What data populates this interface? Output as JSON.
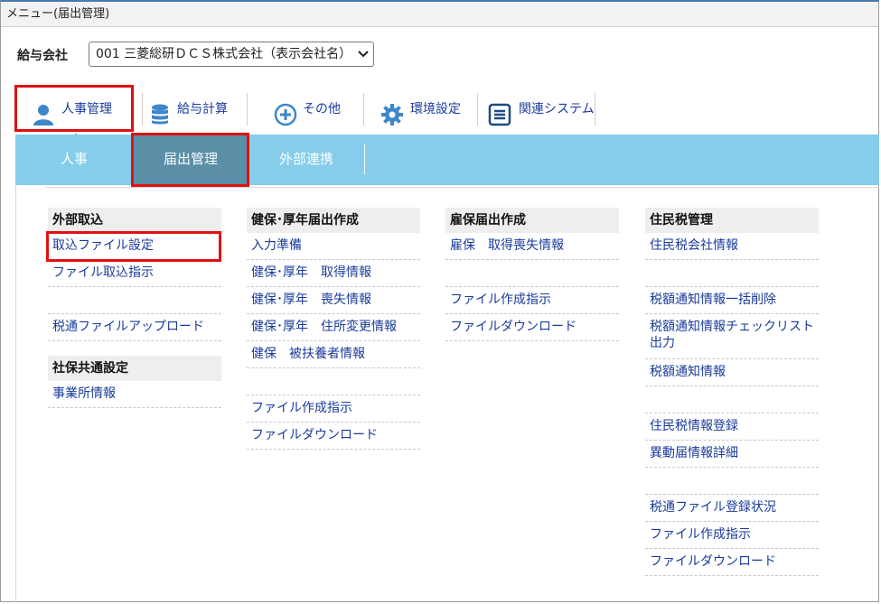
{
  "title_bar": "メニュー(届出管理)",
  "company": {
    "label": "給与会社",
    "selected": "001 三菱総研ＤＣＳ株式会社（表示会社名）"
  },
  "top_menu": [
    {
      "label": "人事管理",
      "icon": "person-icon"
    },
    {
      "label": "給与計算",
      "icon": "database-icon"
    },
    {
      "label": "その他",
      "icon": "plus-circle-icon"
    },
    {
      "label": "環境設定",
      "icon": "gear-icon"
    },
    {
      "label": "関連システム",
      "icon": "list-icon"
    }
  ],
  "sub_tabs": [
    {
      "label": "人事"
    },
    {
      "label": "届出管理"
    },
    {
      "label": "外部連携"
    }
  ],
  "columns": [
    {
      "sections": [
        {
          "heading": "外部取込",
          "items": [
            "取込ファイル設定",
            "ファイル取込指示",
            "",
            "税通ファイルアップロード"
          ]
        },
        {
          "heading": "社保共通設定",
          "items": [
            "事業所情報"
          ]
        }
      ]
    },
    {
      "sections": [
        {
          "heading": "健保･厚年届出作成",
          "items": [
            "入力準備",
            "健保･厚年　取得情報",
            "健保･厚年　喪失情報",
            "健保･厚年　住所変更情報",
            "健保　被扶養者情報",
            "",
            "ファイル作成指示",
            "ファイルダウンロード"
          ]
        }
      ]
    },
    {
      "sections": [
        {
          "heading": "雇保届出作成",
          "items": [
            "雇保　取得喪失情報",
            "",
            "ファイル作成指示",
            "ファイルダウンロード"
          ]
        }
      ]
    },
    {
      "sections": [
        {
          "heading": "住民税管理",
          "items": [
            "住民税会社情報",
            "",
            "税額通知情報一括削除",
            "税額通知情報チェックリスト出力",
            "税額通知情報",
            "",
            "住民税情報登録",
            "異動届情報詳細",
            "",
            "税通ファイル登録状況",
            "ファイル作成指示",
            "ファイルダウンロード"
          ]
        }
      ]
    }
  ],
  "colors": {
    "subnav_bg": "#85cdea",
    "active_tab_bg": "#5b8fa8",
    "link": "#1a3b9c",
    "highlight_box": "#e01010"
  }
}
